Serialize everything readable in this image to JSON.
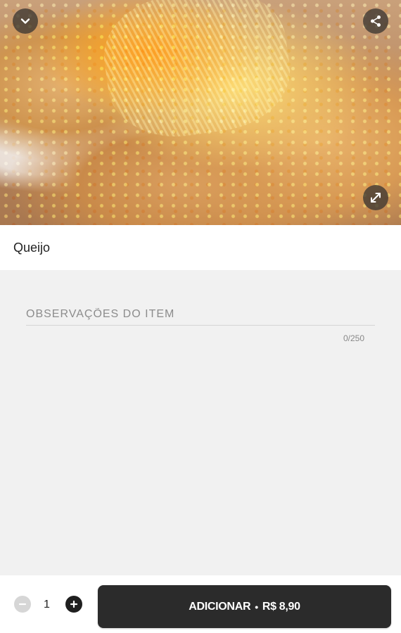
{
  "item": {
    "title": "Queijo"
  },
  "hero": {
    "image_description_icon": "pastel-photo",
    "collapse_icon": "chevron-down-icon",
    "share_icon": "share-icon",
    "expand_icon": "expand-icon"
  },
  "notes": {
    "placeholder": "OBSERVAÇÕES DO ITEM",
    "value": "",
    "counter": "0/250"
  },
  "footer": {
    "quantity": "1",
    "add_label": "ADICIONAR",
    "separator": "•",
    "price": "R$ 8,90"
  },
  "colors": {
    "button_dark": "#2b2b2b",
    "background": "#f1f1f1",
    "minus_disabled": "#d6d6d6"
  }
}
